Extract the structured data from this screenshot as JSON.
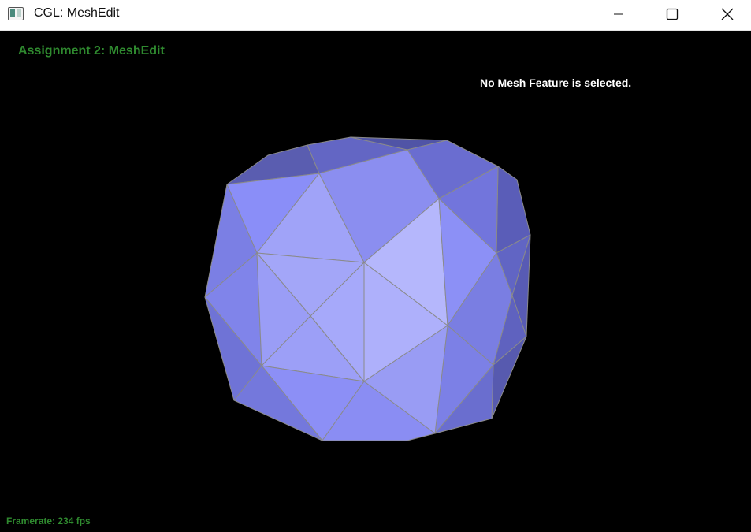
{
  "window": {
    "title": "CGL: MeshEdit",
    "icon": "app-window-icon",
    "controls": [
      "minimize-icon",
      "maximize-icon",
      "close-icon"
    ]
  },
  "hud": {
    "title": "Assignment 2: MeshEdit",
    "status": "No Mesh Feature is selected.",
    "framerate": "Framerate: 234 fps"
  },
  "colors": {
    "hud_title": "#2f8a2f",
    "mesh_fill": "#8f93f5",
    "mesh_edge": "#8a8a8a",
    "background": "#000000"
  }
}
